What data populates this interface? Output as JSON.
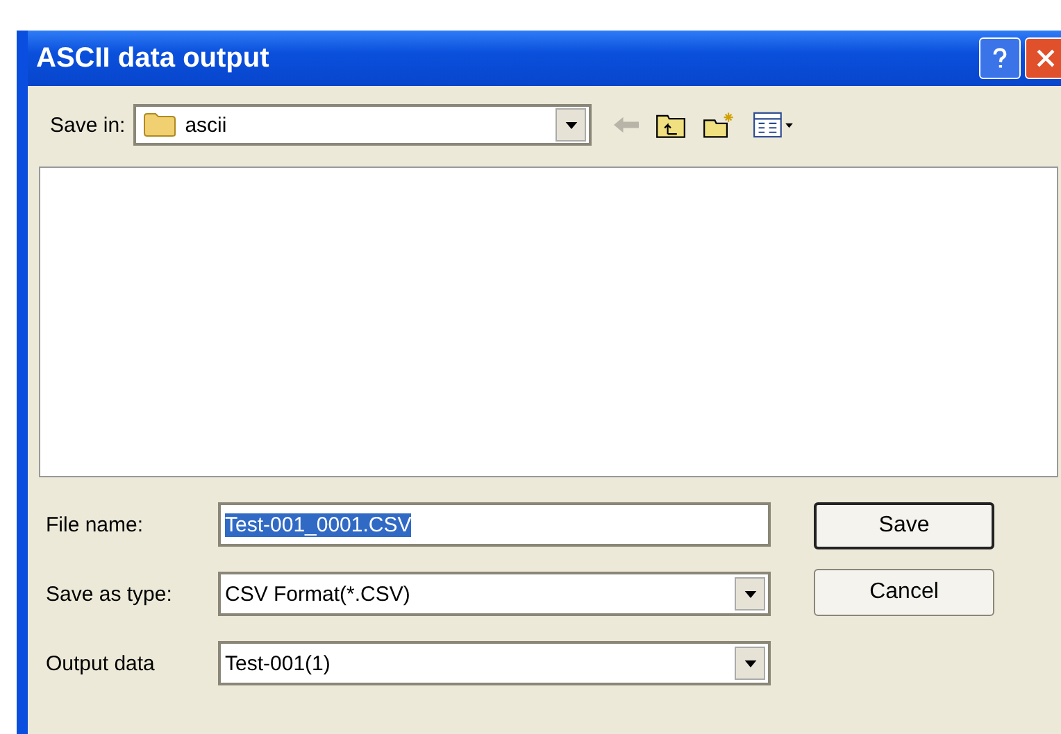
{
  "window": {
    "title": "ASCII data output"
  },
  "save_in": {
    "label": "Save in:",
    "value": "ascii"
  },
  "file_name": {
    "label": "File name:",
    "value": "Test-001_0001.CSV",
    "selected": true
  },
  "save_as_type": {
    "label": "Save as type:",
    "value": "CSV Format(*.CSV)"
  },
  "output_data": {
    "label": "Output data",
    "value": "Test-001(1)"
  },
  "buttons": [
    {
      "label": "Save",
      "default": true
    },
    {
      "label": "Cancel",
      "default": false
    }
  ]
}
